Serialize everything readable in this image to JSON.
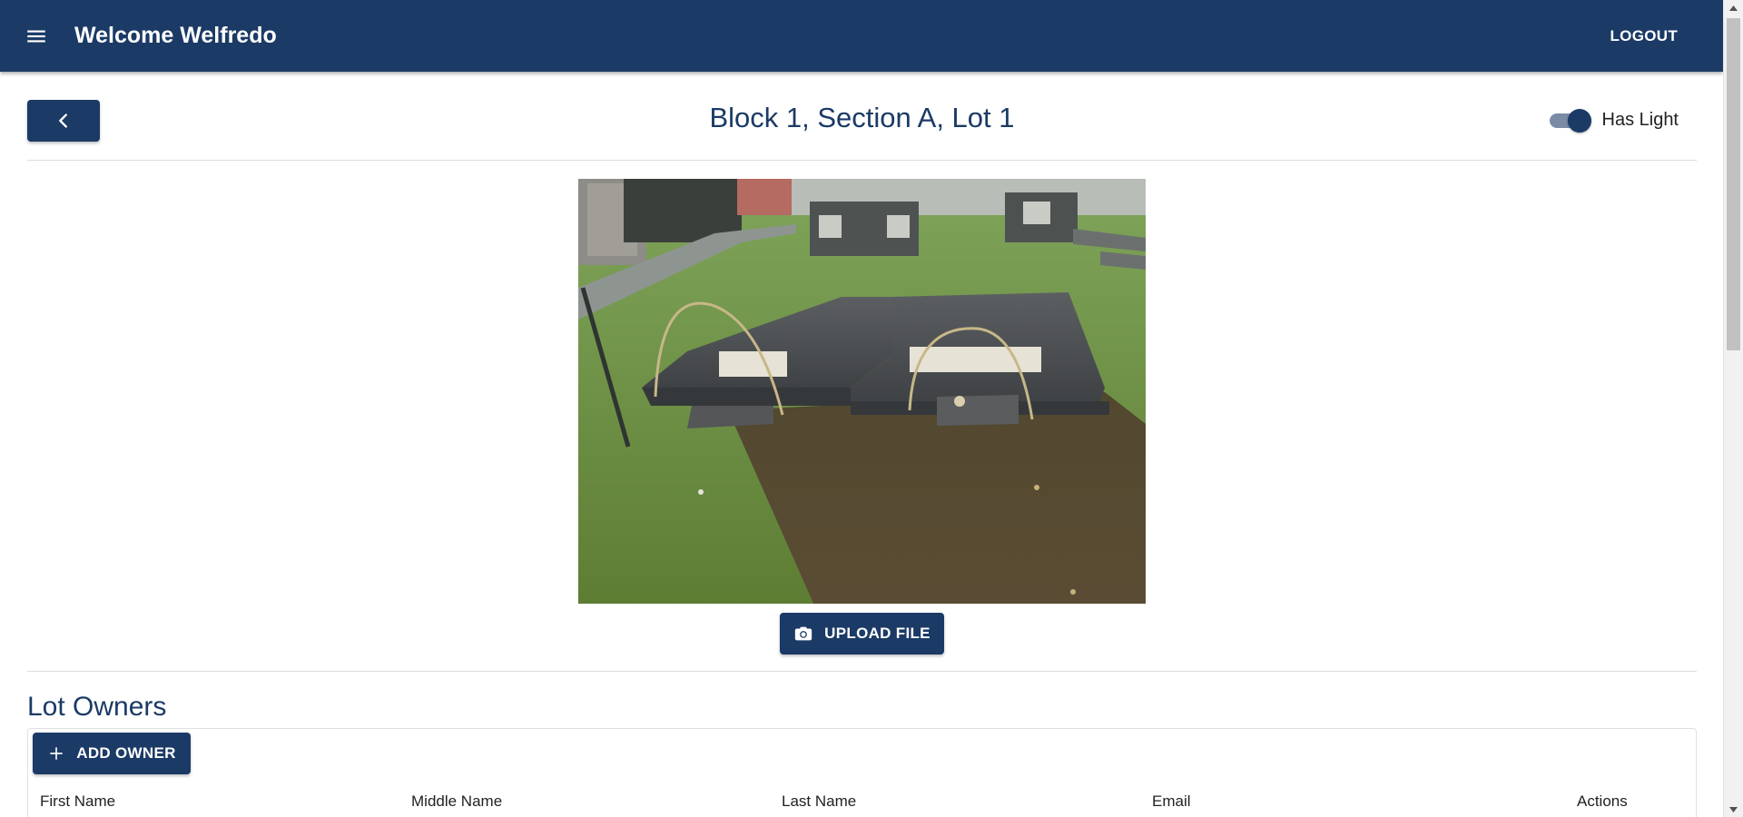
{
  "appbar": {
    "title": "Welcome Welfredo",
    "logout_label": "LOGOUT",
    "menu_icon": "hamburger-menu-icon"
  },
  "header": {
    "title": "Block 1, Section A, Lot 1",
    "back_icon": "chevron-left-icon",
    "has_light": {
      "label": "Has Light",
      "checked": true
    }
  },
  "photo": {
    "upload_label": "UPLOAD FILE",
    "upload_icon": "camera-icon"
  },
  "owners": {
    "heading": "Lot Owners",
    "add_label": "ADD OWNER",
    "add_icon": "plus-icon",
    "columns": [
      "First Name",
      "Middle Name",
      "Last Name",
      "Email",
      "Actions"
    ]
  },
  "colors": {
    "primary": "#1b3a66",
    "toggle_track": "#7a8ba6"
  }
}
